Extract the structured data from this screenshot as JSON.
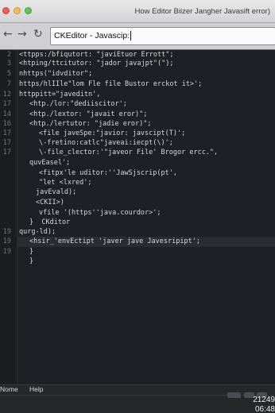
{
  "window": {
    "title": "How Editor Biizer Jangher Javasift error)"
  },
  "toolbar": {
    "back_label": "←",
    "forward_label": "→",
    "reload_label": "↻",
    "address_value": "CKEditor - Javascip:"
  },
  "editor": {
    "lines": [
      {
        "num": "2",
        "text": "<ttpps:/bfiqutort: \"javiEtuor Errott\";"
      },
      {
        "num": "3",
        "text": "<htping/ttcitutor: \"jador javajpt\"(\");"
      },
      {
        "num": "5",
        "text": "nhttps(\"idvditor\";"
      },
      {
        "num": "7",
        "text": "https/hlIIle\"lom Fle file Bustor erckot it>';"
      },
      {
        "num": "12",
        "text": "httppitt=\"javeditn',"
      },
      {
        "num": "17",
        "text": "<htp./lor:\"dediiscitor';"
      },
      {
        "num": "14",
        "text": "<htp./lextor: \"javait eror)\";"
      },
      {
        "num": "16",
        "text": "<htp./lertutor: \"jadie eror)\";"
      },
      {
        "num": "17",
        "text": "<file javeSpe:\"javior: javscipt(T)';"
      },
      {
        "num": "17",
        "text": "\\-fretino:catlc\"javeai:iecpt(\\)';"
      },
      {
        "num": "17",
        "text": "\\-file_clector:'\"javeor File' Brogor ercc.\","
      },
      {
        "num": "",
        "text": "quvEasel';"
      },
      {
        "num": "",
        "text": "<fitpx'le uditor:''JawSjscrip(pt',"
      },
      {
        "num": "",
        "text": "\"let <lxred';"
      },
      {
        "num": "",
        "text": "javEvald);"
      },
      {
        "num": "",
        "text": "<CKII>)"
      },
      {
        "num": "",
        "text": "vfile '(https''java.courdor>';"
      },
      {
        "num": "",
        "text": "}  CKditor"
      },
      {
        "num": "19",
        "text": "qurg-ld);"
      },
      {
        "num": "19",
        "text": "<hsir_'envEctipt 'javer jave Javesripipt';"
      },
      {
        "num": "19",
        "text": "}"
      },
      {
        "num": "",
        "text": "}"
      }
    ]
  },
  "statusbar": {
    "menu_name": "Nome",
    "menu_help": "Help",
    "clock_time": "21249",
    "clock_date": "06:48"
  },
  "colors": {
    "editor_bg": "#1e2025",
    "code_text": "#d6d8dc",
    "line_number": "#6e737d",
    "current_line": "#2a2c31",
    "close_light": "#ee5d55",
    "minimize_light": "#f5bd4f",
    "zoom_light": "#5ec454"
  }
}
